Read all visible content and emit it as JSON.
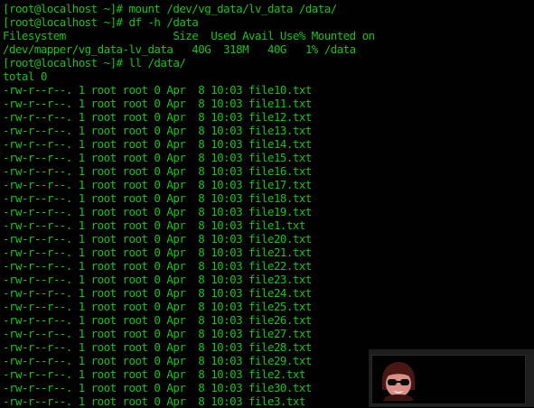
{
  "terminal": {
    "lines": [
      "[root@localhost ~]# mount /dev/vg_data/lv_data /data/",
      "[root@localhost ~]# df -h /data",
      "Filesystem                 Size  Used Avail Use% Mounted on",
      "/dev/mapper/vg_data-lv_data   40G  318M   40G   1% /data",
      "[root@localhost ~]# ll /data/",
      "total 0",
      "-rw-r--r--. 1 root root 0 Apr  8 10:03 file10.txt",
      "-rw-r--r--. 1 root root 0 Apr  8 10:03 file11.txt",
      "-rw-r--r--. 1 root root 0 Apr  8 10:03 file12.txt",
      "-rw-r--r--. 1 root root 0 Apr  8 10:03 file13.txt",
      "-rw-r--r--. 1 root root 0 Apr  8 10:03 file14.txt",
      "-rw-r--r--. 1 root root 0 Apr  8 10:03 file15.txt",
      "-rw-r--r--. 1 root root 0 Apr  8 10:03 file16.txt",
      "-rw-r--r--. 1 root root 0 Apr  8 10:03 file17.txt",
      "-rw-r--r--. 1 root root 0 Apr  8 10:03 file18.txt",
      "-rw-r--r--. 1 root root 0 Apr  8 10:03 file19.txt",
      "-rw-r--r--. 1 root root 0 Apr  8 10:03 file1.txt",
      "-rw-r--r--. 1 root root 0 Apr  8 10:03 file20.txt",
      "-rw-r--r--. 1 root root 0 Apr  8 10:03 file21.txt",
      "-rw-r--r--. 1 root root 0 Apr  8 10:03 file22.txt",
      "-rw-r--r--. 1 root root 0 Apr  8 10:03 file23.txt",
      "-rw-r--r--. 1 root root 0 Apr  8 10:03 file24.txt",
      "-rw-r--r--. 1 root root 0 Apr  8 10:03 file25.txt",
      "-rw-r--r--. 1 root root 0 Apr  8 10:03 file26.txt",
      "-rw-r--r--. 1 root root 0 Apr  8 10:03 file27.txt",
      "-rw-r--r--. 1 root root 0 Apr  8 10:03 file28.txt",
      "-rw-r--r--. 1 root root 0 Apr  8 10:03 file29.txt",
      "-rw-r--r--. 1 root root 0 Apr  8 10:03 file2.txt",
      "-rw-r--r--. 1 root root 0 Apr  8 10:03 file30.txt",
      "-rw-r--r--. 1 root root 0 Apr  8 10:03 file3.txt"
    ]
  },
  "overlay": {
    "icon": "sunglasses-avatar-icon"
  },
  "colors": {
    "background": "#000000",
    "text": "#1ec21e",
    "overlay_frame": "#1e1e1e",
    "avatar_face": "#d98f86",
    "avatar_hair": "#4a1612"
  }
}
